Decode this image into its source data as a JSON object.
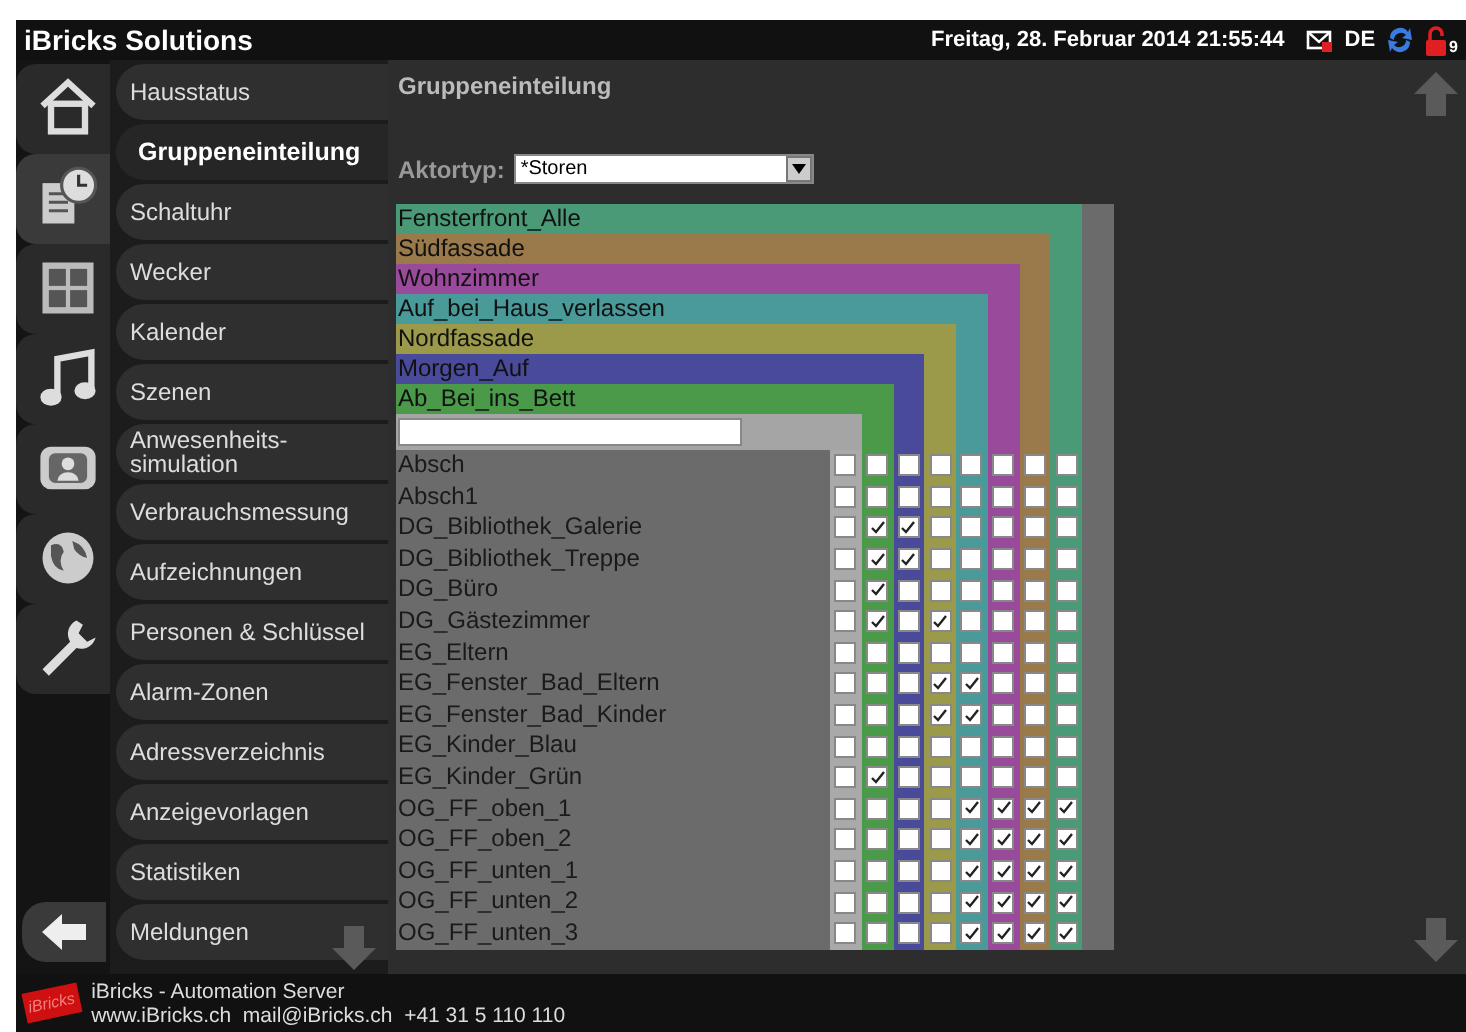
{
  "header": {
    "title": "iBricks Solutions",
    "datetime": "Freitag, 28. Februar 2014 21:55:44",
    "language": "DE",
    "lock_badge": "9"
  },
  "nav_icons": [
    {
      "kind": "home",
      "selected": false
    },
    {
      "kind": "schedule",
      "selected": true
    },
    {
      "kind": "grid",
      "selected": false
    },
    {
      "kind": "music",
      "selected": false
    },
    {
      "kind": "tv",
      "selected": false
    },
    {
      "kind": "globe",
      "selected": false
    },
    {
      "kind": "wrench",
      "selected": false
    }
  ],
  "menu": [
    {
      "label": "Hausstatus",
      "selected": false
    },
    {
      "label": "Gruppeneinteilung",
      "selected": true
    },
    {
      "label": "Schaltuhr",
      "selected": false
    },
    {
      "label": "Wecker",
      "selected": false
    },
    {
      "label": "Kalender",
      "selected": false
    },
    {
      "label": "Szenen",
      "selected": false
    },
    {
      "label": "Anwesenheits-\nsimulation",
      "selected": false
    },
    {
      "label": "Verbrauchsmessung",
      "selected": false
    },
    {
      "label": "Aufzeichnungen",
      "selected": false
    },
    {
      "label": "Personen & Schlüssel",
      "selected": false
    },
    {
      "label": "Alarm-Zonen",
      "selected": false
    },
    {
      "label": "Adressverzeichnis",
      "selected": false
    },
    {
      "label": "Anzeigevorlagen",
      "selected": false
    },
    {
      "label": "Statistiken",
      "selected": false
    },
    {
      "label": "Meldungen",
      "selected": false
    }
  ],
  "page_title": "Gruppeneinteilung",
  "aktortyp": {
    "label": "Aktortyp:",
    "value": "*Storen"
  },
  "groups": [
    {
      "name": "Fensterfront_Alle",
      "color": "#4a9a78"
    },
    {
      "name": "Südfassade",
      "color": "#9a7a4a"
    },
    {
      "name": "Wohnzimmer",
      "color": "#9a4a9a"
    },
    {
      "name": "Auf_bei_Haus_verlassen",
      "color": "#4a9a9a"
    },
    {
      "name": "Nordfassade",
      "color": "#9a9a4a"
    },
    {
      "name": "Morgen_Auf",
      "color": "#4a4a9a"
    },
    {
      "name": "Ab_Bei_ins_Bett",
      "color": "#4a9a4a"
    }
  ],
  "actuators": [
    {
      "name": "Absch",
      "checks": [
        false,
        false,
        false,
        false,
        false,
        false,
        false,
        false
      ]
    },
    {
      "name": "Absch1",
      "checks": [
        false,
        false,
        false,
        false,
        false,
        false,
        false,
        false
      ]
    },
    {
      "name": "DG_Bibliothek_Galerie",
      "checks": [
        false,
        true,
        true,
        false,
        false,
        false,
        false,
        false
      ]
    },
    {
      "name": "DG_Bibliothek_Treppe",
      "checks": [
        false,
        true,
        true,
        false,
        false,
        false,
        false,
        false
      ]
    },
    {
      "name": "DG_Büro",
      "checks": [
        false,
        true,
        false,
        false,
        false,
        false,
        false,
        false
      ]
    },
    {
      "name": "DG_Gästezimmer",
      "checks": [
        false,
        true,
        false,
        true,
        false,
        false,
        false,
        false
      ]
    },
    {
      "name": "EG_Eltern",
      "checks": [
        false,
        false,
        false,
        false,
        false,
        false,
        false,
        false
      ]
    },
    {
      "name": "EG_Fenster_Bad_Eltern",
      "checks": [
        false,
        false,
        false,
        true,
        true,
        false,
        false,
        false
      ]
    },
    {
      "name": "EG_Fenster_Bad_Kinder",
      "checks": [
        false,
        false,
        false,
        true,
        true,
        false,
        false,
        false
      ]
    },
    {
      "name": "EG_Kinder_Blau",
      "checks": [
        false,
        false,
        false,
        false,
        false,
        false,
        false,
        false
      ]
    },
    {
      "name": "EG_Kinder_Grün",
      "checks": [
        false,
        true,
        false,
        false,
        false,
        false,
        false,
        false
      ]
    },
    {
      "name": "OG_FF_oben_1",
      "checks": [
        false,
        false,
        false,
        false,
        true,
        true,
        true,
        true
      ]
    },
    {
      "name": "OG_FF_oben_2",
      "checks": [
        false,
        false,
        false,
        false,
        true,
        true,
        true,
        true
      ]
    },
    {
      "name": "OG_FF_unten_1",
      "checks": [
        false,
        false,
        false,
        false,
        true,
        true,
        true,
        true
      ]
    },
    {
      "name": "OG_FF_unten_2",
      "checks": [
        false,
        false,
        false,
        false,
        true,
        true,
        true,
        true
      ]
    },
    {
      "name": "OG_FF_unten_3",
      "checks": [
        false,
        false,
        false,
        false,
        true,
        true,
        true,
        true
      ]
    }
  ],
  "footer": {
    "logo": "iBricks",
    "title": "iBricks - Automation Server",
    "contact": "www.iBricks.ch  mail@iBricks.ch  +41 31 5 110 110"
  }
}
